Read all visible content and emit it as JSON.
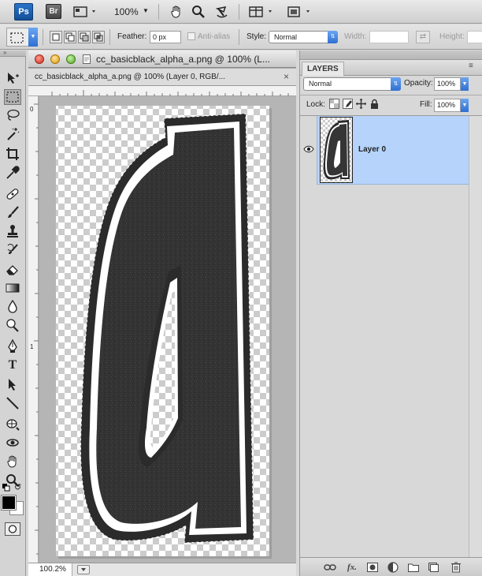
{
  "app": {
    "ps_label": "Ps",
    "br_label": "Br",
    "zoom": "100%"
  },
  "options": {
    "feather_label": "Feather:",
    "feather_value": "0 px",
    "antialias_label": "Anti-alias",
    "style_label": "Style:",
    "style_value": "Normal",
    "width_label": "Width:",
    "height_label": "Height:"
  },
  "document": {
    "window_title": "cc_basicblack_alpha_a.png @ 100% (L...",
    "tab_title": "cc_basicblack_alpha_a.png @ 100% (Layer 0, RGB/...",
    "ruler_left_marks": [
      "0",
      "1"
    ],
    "zoom_status": "100.2%"
  },
  "layers": {
    "tab_label": "LAYERS",
    "blend_mode": "Normal",
    "opacity_label": "Opacity:",
    "opacity_value": "100%",
    "lock_label": "Lock:",
    "fill_label": "Fill:",
    "fill_value": "100%",
    "items": [
      {
        "name": "Layer 0",
        "visible": true,
        "selected": true
      }
    ]
  },
  "colors": {
    "foreground": "#000000",
    "background": "#ffffff",
    "selection": "#b5d3fb",
    "accent": "#2f6fd1"
  }
}
